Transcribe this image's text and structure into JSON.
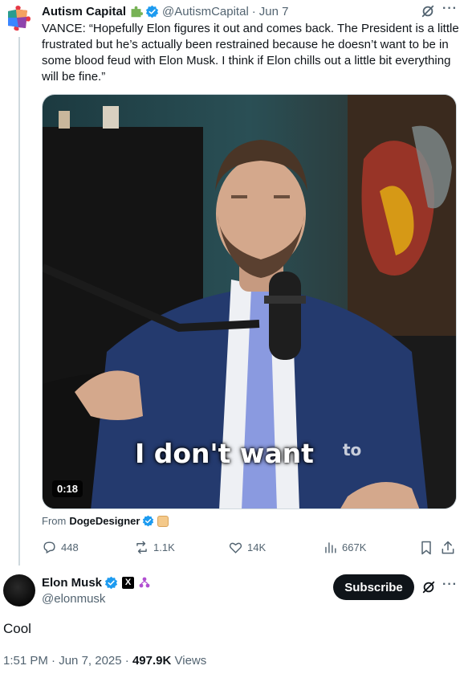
{
  "quoted_tweet": {
    "author_name": "Autism Capital",
    "author_emoji": "puzzle-piece-emoji",
    "author_handle": "@AutismCapital",
    "separator": "·",
    "date": "Jun 7",
    "more": "···",
    "text": "VANCE: “Hopefully Elon figures it out and comes back. The President is a little frustrated but he’s actually been restrained because he doesn’t want to be in some blood feud with Elon Musk. I think if Elon chills out a little bit everything will be fine.”",
    "video": {
      "caption": "I don't want",
      "caption_tail": "to",
      "duration": "0:18"
    },
    "from_label": "From",
    "from_name": "DogeDesigner",
    "actions": {
      "replies": "448",
      "reposts": "1.1K",
      "likes": "14K",
      "views": "667K"
    }
  },
  "main_tweet": {
    "author_name": "Elon Musk",
    "affiliation_badge": "X",
    "author_handle": "@elonmusk",
    "subscribe_label": "Subscribe",
    "more": "···",
    "text": "Cool",
    "time": "1:51 PM",
    "separator": "·",
    "date": "Jun 7, 2025",
    "views_count": "497.9K",
    "views_label": "Views"
  },
  "colors": {
    "verified_blue": "#1d9bf0",
    "secondary_text": "#536471",
    "primary_text": "#0f1419",
    "thread_line": "#cfd9de",
    "subscribe_bg": "#0f1419"
  }
}
